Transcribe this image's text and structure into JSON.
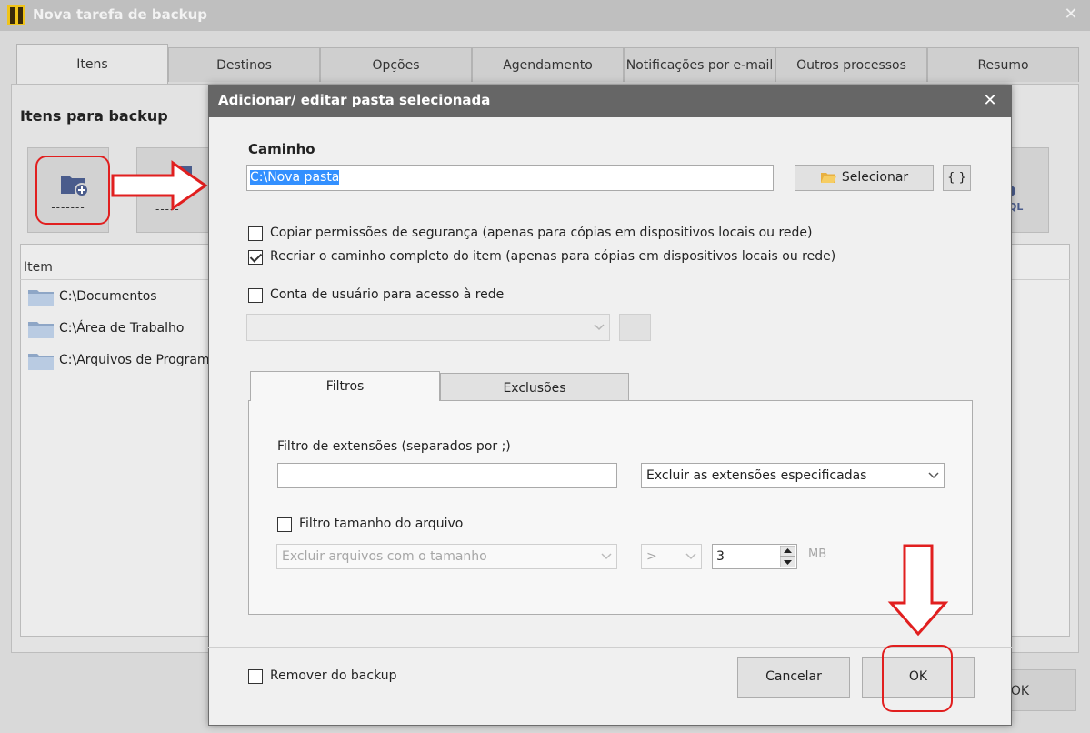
{
  "main_window": {
    "title": "Nova tarefa de backup",
    "tabs": [
      {
        "label": "Itens",
        "active": true
      },
      {
        "label": "Destinos"
      },
      {
        "label": "Opções"
      },
      {
        "label": "Agendamento"
      },
      {
        "label": "Notificações por e-mail"
      },
      {
        "label": "Outros processos"
      },
      {
        "label": "Resumo"
      }
    ],
    "section_heading": "Itens para backup",
    "toolbar": {
      "add_folder_label": "-------",
      "second_button_label": "-----",
      "right_button_label": "QL"
    },
    "list_column_header": "Item",
    "list_items": [
      "C:\\Documentos",
      "C:\\Área de Trabalho",
      "C:\\Arquivos de Programas"
    ],
    "ok_fragment": "OK"
  },
  "dialog": {
    "title": "Adicionar/ editar pasta selecionada",
    "path_label": "Caminho",
    "path_value": "C:\\Nova pasta",
    "select_button": "Selecionar",
    "braces_button": "{ }",
    "copy_permissions": {
      "label": "Copiar permissões de segurança (apenas para cópias em dispositivos locais ou rede)",
      "checked": false
    },
    "recreate_path": {
      "label": "Recriar o caminho completo do item (apenas para cópias em dispositivos locais ou rede)",
      "checked": true
    },
    "user_account": {
      "label": "Conta de usuário para acesso à rede",
      "checked": false
    },
    "subtabs": [
      {
        "label": "Filtros",
        "active": true
      },
      {
        "label": "Exclusões"
      }
    ],
    "ext_filter_label": "Filtro de extensões (separados por ;)",
    "ext_filter_value": "",
    "ext_filter_mode": "Excluir as extensões especificadas",
    "size_filter": {
      "label": "Filtro tamanho do arquivo",
      "checked": false
    },
    "size_mode": "Excluir arquivos com o tamanho",
    "size_operator": ">",
    "size_value": "3",
    "size_unit": "MB",
    "remove_from_backup": {
      "label": "Remover do backup",
      "checked": false
    },
    "cancel_button": "Cancelar",
    "ok_button": "OK"
  },
  "colors": {
    "accent_red": "#e11f1f",
    "dialog_title_bg": "#666666",
    "selection_blue": "#3390ff",
    "folder_icon": "#4a5c8c"
  }
}
